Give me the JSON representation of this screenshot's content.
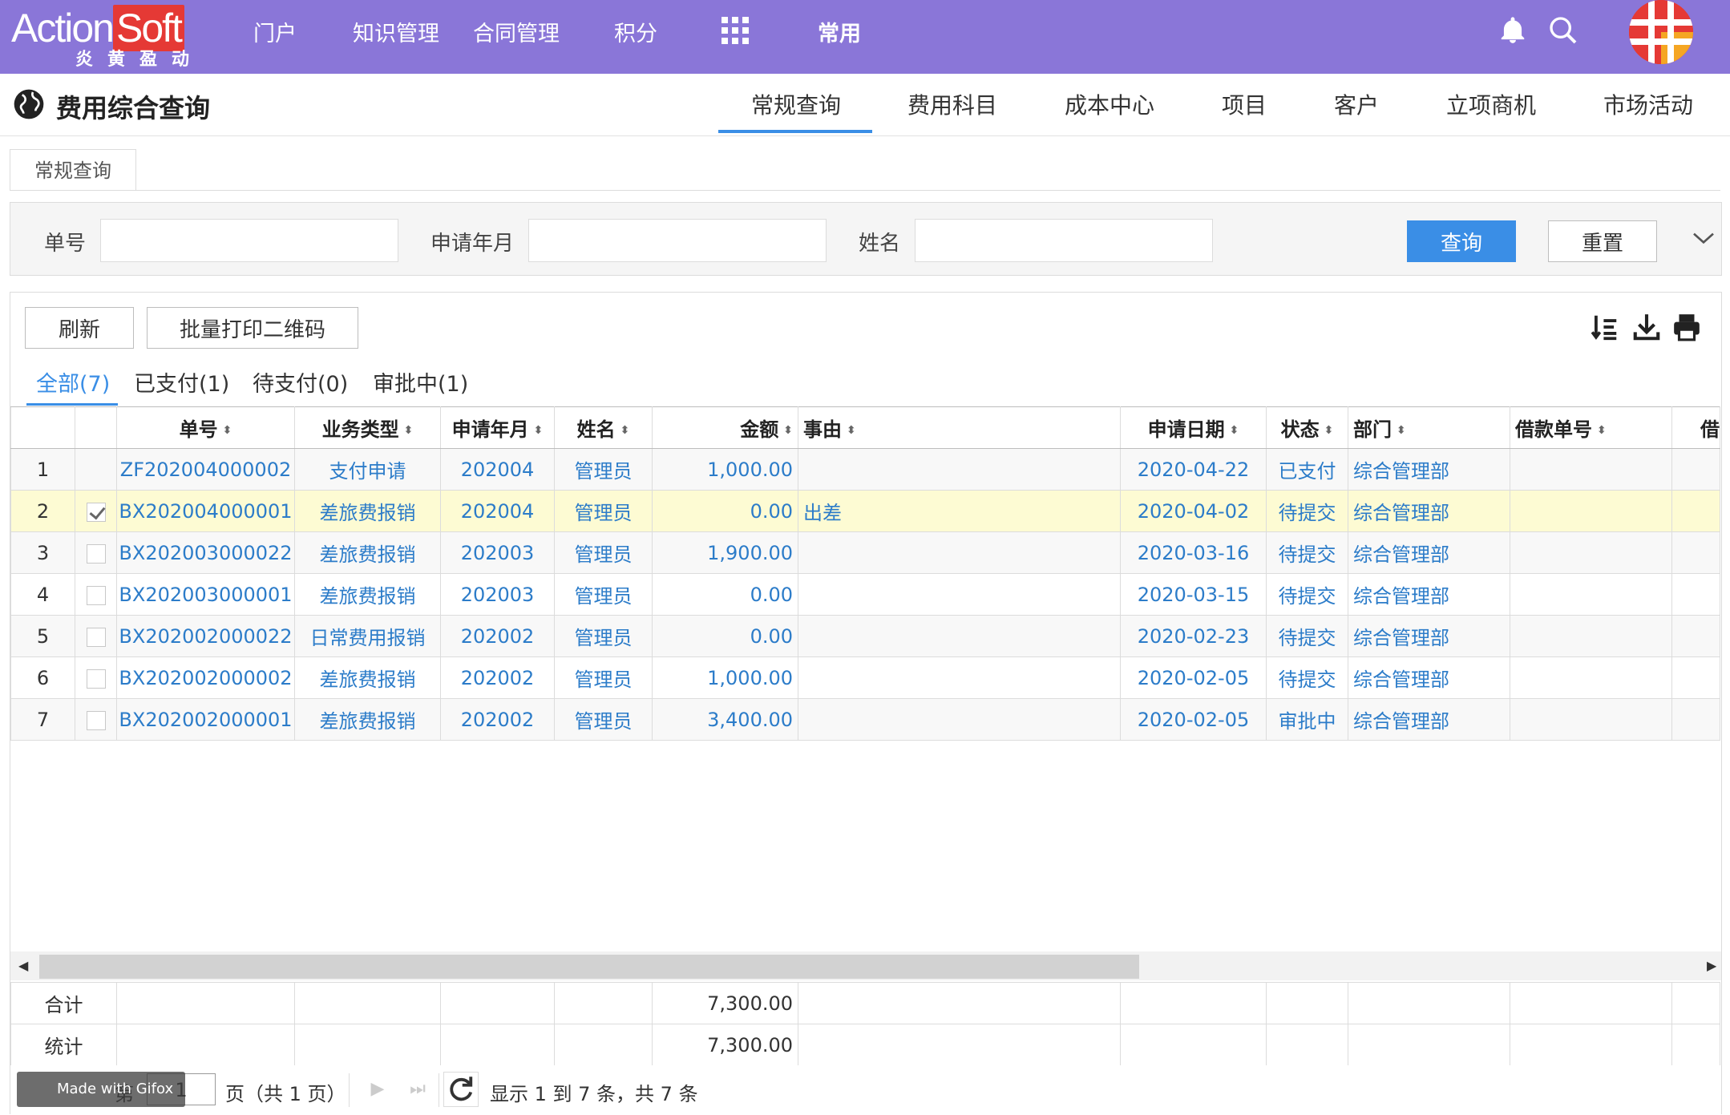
{
  "app": {
    "logo_text_a": "Action",
    "logo_text_b": "Soft",
    "logo_sub": "炎黄盈动",
    "nav": [
      "门户",
      "知识管理",
      "合同管理",
      "积分",
      "常用"
    ],
    "accent": "#8a76d8",
    "primary": "#3a8ee6"
  },
  "page": {
    "title": "费用综合查询",
    "tabs": [
      "常规查询",
      "费用科目",
      "成本中心",
      "项目",
      "客户",
      "立项商机",
      "市场活动"
    ],
    "active_tab": "常规查询"
  },
  "subtab": {
    "label": "常规查询"
  },
  "search": {
    "fields": [
      {
        "label": "单号",
        "value": ""
      },
      {
        "label": "申请年月",
        "value": ""
      },
      {
        "label": "姓名",
        "value": ""
      }
    ],
    "query_label": "查询",
    "reset_label": "重置"
  },
  "toolbar": {
    "refresh_label": "刷新",
    "print_qr_label": "批量打印二维码"
  },
  "filter_tabs": [
    "全部(7)",
    "已支付(1)",
    "待支付(0)",
    "审批中(1)"
  ],
  "table": {
    "columns": [
      "单号",
      "业务类型",
      "申请年月",
      "姓名",
      "金额",
      "事由",
      "申请日期",
      "状态",
      "部门",
      "借款单号",
      "借"
    ],
    "rows": [
      {
        "idx": "1",
        "no": "ZF202004000002",
        "type": "支付申请",
        "ym": "202004",
        "name": "管理员",
        "amount": "1,000.00",
        "reason": "",
        "date": "2020-04-22",
        "status": "已支付",
        "dept": "综合管理部",
        "loan": "",
        "checked": false,
        "nocheck": true
      },
      {
        "idx": "2",
        "no": "BX202004000001",
        "type": "差旅费报销",
        "ym": "202004",
        "name": "管理员",
        "amount": "0.00",
        "reason": "出差",
        "date": "2020-04-02",
        "status": "待提交",
        "dept": "综合管理部",
        "loan": "",
        "checked": true
      },
      {
        "idx": "3",
        "no": "BX202003000022",
        "type": "差旅费报销",
        "ym": "202003",
        "name": "管理员",
        "amount": "1,900.00",
        "reason": "",
        "date": "2020-03-16",
        "status": "待提交",
        "dept": "综合管理部",
        "loan": "",
        "checked": false
      },
      {
        "idx": "4",
        "no": "BX202003000001",
        "type": "差旅费报销",
        "ym": "202003",
        "name": "管理员",
        "amount": "0.00",
        "reason": "",
        "date": "2020-03-15",
        "status": "待提交",
        "dept": "综合管理部",
        "loan": "",
        "checked": false
      },
      {
        "idx": "5",
        "no": "BX202002000022",
        "type": "日常费用报销",
        "ym": "202002",
        "name": "管理员",
        "amount": "0.00",
        "reason": "",
        "date": "2020-02-23",
        "status": "待提交",
        "dept": "综合管理部",
        "loan": "",
        "checked": false
      },
      {
        "idx": "6",
        "no": "BX202002000002",
        "type": "差旅费报销",
        "ym": "202002",
        "name": "管理员",
        "amount": "1,000.00",
        "reason": "",
        "date": "2020-02-05",
        "status": "待提交",
        "dept": "综合管理部",
        "loan": "",
        "checked": false
      },
      {
        "idx": "7",
        "no": "BX202002000001",
        "type": "差旅费报销",
        "ym": "202002",
        "name": "管理员",
        "amount": "3,400.00",
        "reason": "",
        "date": "2020-02-05",
        "status": "审批中",
        "dept": "综合管理部",
        "loan": "",
        "checked": false
      }
    ],
    "summary": [
      {
        "label": "合计",
        "amount": "7,300.00"
      },
      {
        "label": "统计",
        "amount": "7,300.00"
      }
    ]
  },
  "pager": {
    "prefix": "第",
    "page": "1",
    "suffix": "页（共 1 页）",
    "info": "显示 1 到 7 条，共 7 条"
  },
  "watermark": "Made with Gifox"
}
